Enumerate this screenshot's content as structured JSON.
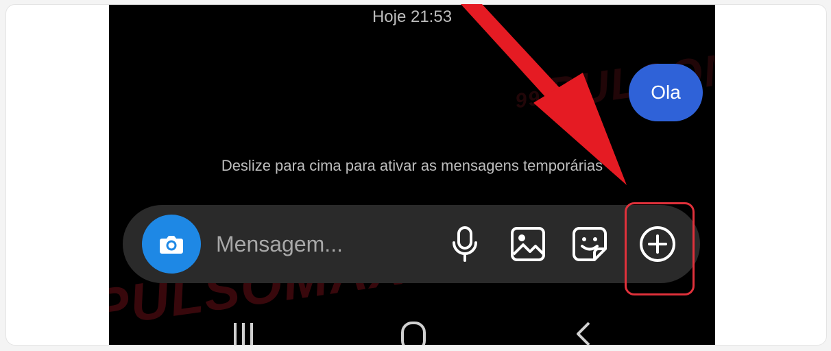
{
  "conversation": {
    "timestamp": "Hoje 21:53",
    "messages": [
      {
        "text": "Ola",
        "direction": "outgoing"
      }
    ],
    "temporary_hint": "Deslize para cima para ativar as mensagens temporárias"
  },
  "composer": {
    "placeholder": "Mensagem...",
    "buttons": {
      "camera": "camera-icon",
      "voice": "microphone-icon",
      "gallery": "image-icon",
      "sticker": "sticker-icon",
      "more": "plus-circle-icon"
    }
  },
  "watermark": {
    "text": "PULSOMAX",
    "badge": "99"
  },
  "navigation": [
    "recent-apps-icon",
    "home-icon",
    "back-icon"
  ],
  "colors": {
    "bubble": "#2f62d8",
    "camera_button": "#1e88e5",
    "composer_bg": "#2a2a2a",
    "highlight": "#e0313b",
    "arrow": "#e51b23"
  }
}
